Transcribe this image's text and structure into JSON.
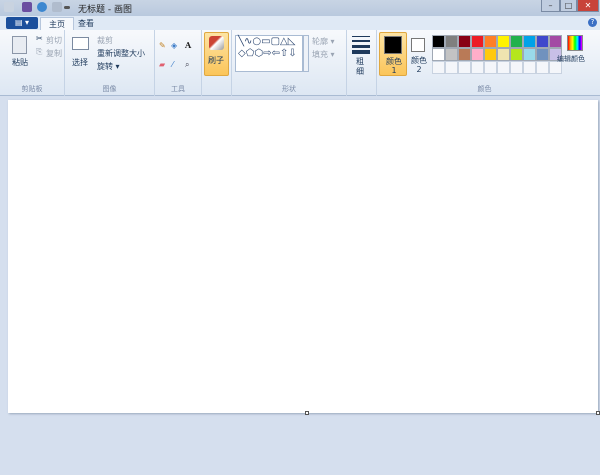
{
  "window": {
    "title": "无标题 - 画图",
    "minimize": "–",
    "maximize": "□",
    "close": "✕"
  },
  "tabs": {
    "file": "▤ ▾",
    "home": "主页",
    "view": "查看"
  },
  "clipboard": {
    "paste": "粘贴",
    "cut": "剪切",
    "copy": "复制",
    "label": "剪贴板"
  },
  "image": {
    "select": "选择",
    "crop": "裁剪",
    "resize": "重新调整大小",
    "rotate": "旋转 ▾",
    "label": "图像"
  },
  "tools": {
    "label": "工具",
    "text_icon": "A"
  },
  "brush": {
    "label": "刷子"
  },
  "shapes": {
    "outline": "轮廓 ▾",
    "fill": "填充 ▾",
    "label": "形状",
    "glyphs": "╲∿○▭▢△◺◇⬠⬡⇨⇦⇧⇩"
  },
  "size": {
    "label": "粗细"
  },
  "colors": {
    "color1": "颜色 1",
    "color2": "颜色 2",
    "edit": "编辑颜色",
    "label": "颜色",
    "color1_value": "#000000",
    "color2_value": "#ffffff",
    "palette_row1": [
      "#000000",
      "#7f7f7f",
      "#880015",
      "#ed1c24",
      "#ff7f27",
      "#fff200",
      "#22b14c",
      "#00a2e8",
      "#3f48cc",
      "#a349a4"
    ],
    "palette_row2": [
      "#ffffff",
      "#c3c3c3",
      "#b97a57",
      "#ffaec9",
      "#ffc90e",
      "#efe4b0",
      "#b5e61d",
      "#99d9ea",
      "#7092be",
      "#c8bfe7"
    ]
  },
  "help": "?"
}
